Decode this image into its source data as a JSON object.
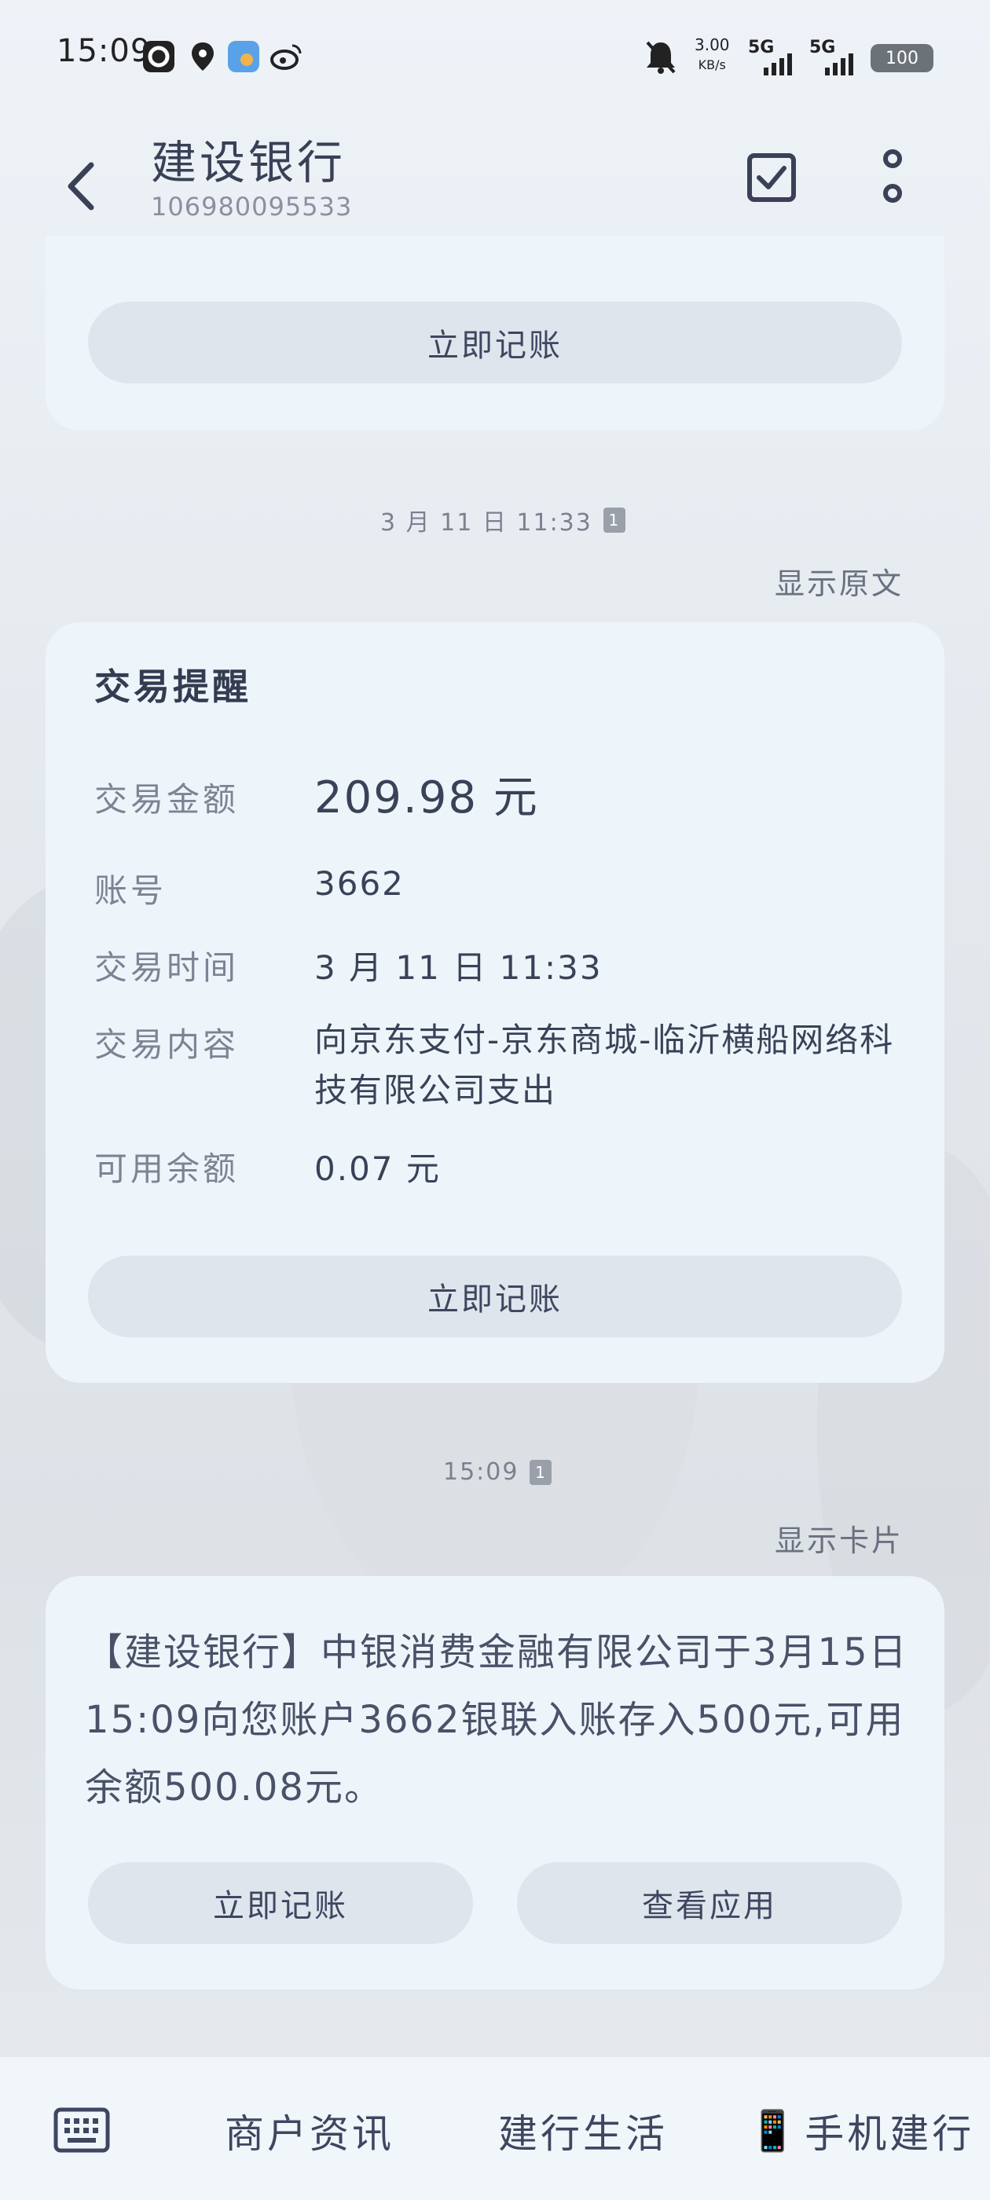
{
  "status_bar": {
    "time": "15:09",
    "net_speed_value": "3.00",
    "net_speed_unit": "KB/s",
    "signal1": "5G",
    "signal2": "5G",
    "battery": "100"
  },
  "header": {
    "title": "建设银行",
    "phone_number": "106980095533"
  },
  "top_card": {
    "record_button": "立即记账"
  },
  "message1": {
    "timestamp": "3 月 11 日 11:33",
    "sim_badge": "1",
    "toggle": "显示原文",
    "card_title": "交易提醒",
    "rows": [
      {
        "label": "交易金额",
        "value": "209.98 元"
      },
      {
        "label": "账号",
        "value": "3662"
      },
      {
        "label": "交易时间",
        "value": "3 月 11 日 11:33"
      },
      {
        "label": "交易内容",
        "value": "向京东支付-京东商城-临沂横船网络科技有限公司支出"
      },
      {
        "label": "可用余额",
        "value": "0.07 元"
      }
    ],
    "record_button": "立即记账"
  },
  "message2": {
    "timestamp": "15:09",
    "sim_badge": "1",
    "toggle": "显示卡片",
    "text": "【建设银行】中银消费金融有限公司于3月15日15:09向您账户3662银联入账存入500元,可用余额500.08元。",
    "record_button": "立即记账",
    "view_app_button": "查看应用"
  },
  "bottom_bar": {
    "item1": "商户资讯",
    "item2": "建行生活",
    "item3": "手机建行",
    "item3_icon": "📱"
  },
  "colors": {
    "card_bg": "#eef5fa",
    "pill_bg": "#dfe5ec",
    "text_main": "#3e4660"
  }
}
